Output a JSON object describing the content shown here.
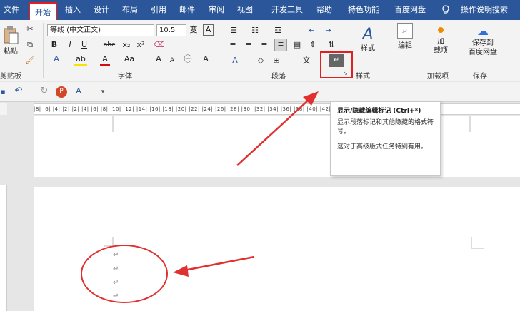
{
  "tabs": [
    "文件",
    "开始",
    "插入",
    "设计",
    "布局",
    "引用",
    "邮件",
    "审阅",
    "视图",
    "开发工具",
    "帮助",
    "特色功能",
    "百度网盘",
    "操作说明搜索"
  ],
  "ribbon": {
    "clipboard": {
      "paste_label": "粘贴",
      "group_label": "剪贴板"
    },
    "font": {
      "font_name": "等线 (中文正文)",
      "font_size": "10.5",
      "wen_icon": "变",
      "bold": "B",
      "italic": "I",
      "underline": "U",
      "strike": "abc",
      "sub": "x₂",
      "sup": "x²",
      "font_color": "A",
      "change_case": "Aa",
      "grow": "A",
      "shrink": "A",
      "group_label": "字体"
    },
    "paragraph": {
      "group_label": "段落"
    },
    "styles": {
      "label": "样式",
      "group_label": "样式"
    },
    "editing": {
      "label": "编辑"
    },
    "addins": {
      "label_line1": "加",
      "label_line2": "载项",
      "group_label": "加载项"
    },
    "save": {
      "label_line1": "保存到",
      "label_line2": "百度网盘",
      "group_label": "保存"
    }
  },
  "ruler_text": "|8|  |6|  |4|  |2|     |2|  |4|  |6|  |8|  |10|  |12|  |14|  |16|  |18|  |20|  |22|  |24|  |26|  |28|  |30|  |32|  |34|  |36|  |38|  |40|  |42|  |44|",
  "tooltip": {
    "title": "显示/隐藏编辑标记 (Ctrl+*)",
    "line1": "显示段落标记和其他隐藏的格式符号。",
    "line2": "这对于高级版式任务特别有用。"
  },
  "pilcrow": "↵",
  "colors": {
    "tabbar": "#2b579a",
    "highlight": "#e02020",
    "arrow": "#e03030"
  },
  "icons": [
    "paste-icon",
    "cut-icon",
    "copy-icon",
    "format-painter-icon",
    "show-hide-marks-icon",
    "styles-icon",
    "find-icon",
    "addin-icon",
    "baidu-cloud-icon",
    "lightbulb-icon",
    "save-icon",
    "undo-icon",
    "redo-icon"
  ]
}
